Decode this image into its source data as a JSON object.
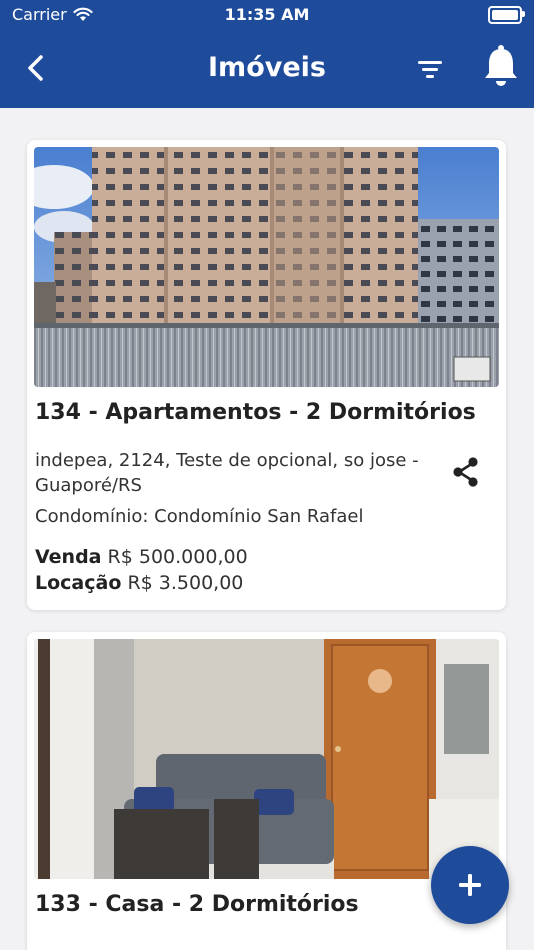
{
  "status_bar": {
    "carrier": "Carrier",
    "time": "11:35 AM"
  },
  "header": {
    "title": "Imóveis"
  },
  "listings": [
    {
      "name": "134 - Apartamentos - 2 Dormitórios",
      "address": "indepea, 2124, Teste de  opcional, so jose - Guaporé/RS",
      "condominium": "Condomínio: Condomínio San Rafael",
      "sale_label": "Venda",
      "sale_price": "R$ 500.000,00",
      "rent_label": "Locação",
      "rent_price": "R$ 3.500,00"
    },
    {
      "name": "133 - Casa - 2 Dormitórios"
    }
  ],
  "colors": {
    "primary": "#1f4b9b",
    "background": "#f2f2f4"
  }
}
